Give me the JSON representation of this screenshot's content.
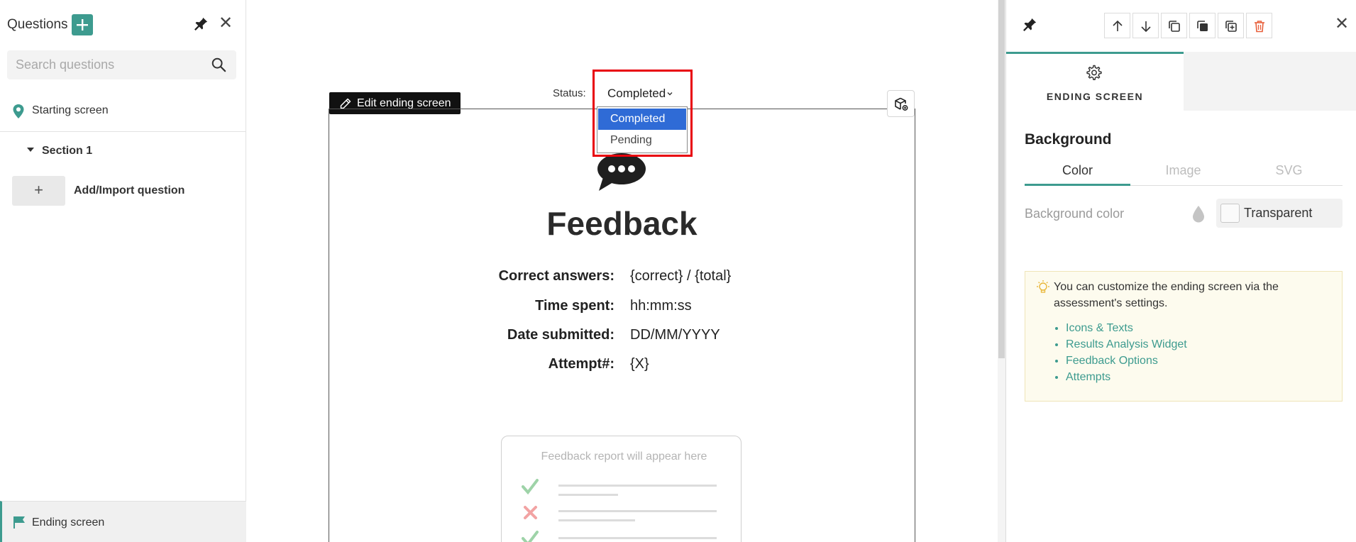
{
  "left_panel": {
    "title": "Questions",
    "add_icon": "plus-icon",
    "search_placeholder": "Search questions",
    "starting_screen": "Starting screen",
    "section": "Section 1",
    "add_import_symbol": "+",
    "add_import_label": "Add/Import question",
    "ending_screen": "Ending screen",
    "close_symbol": "✕"
  },
  "canvas": {
    "status_label": "Status:",
    "status_value": "Completed",
    "dropdown_options": [
      "Completed",
      "Pending"
    ],
    "edit_button": "Edit ending screen",
    "title": "Feedback",
    "rows": [
      {
        "key": "Correct answers:",
        "value": "{correct} / {total}"
      },
      {
        "key": "Time spent:",
        "value": "hh:mm:ss"
      },
      {
        "key": "Date submitted:",
        "value": "DD/MM/YYYY"
      },
      {
        "key": "Attempt#:",
        "value": "{X}"
      }
    ],
    "report_placeholder": "Feedback report will appear here"
  },
  "right_panel": {
    "tab_label": "ENDING SCREEN",
    "section_title": "Background",
    "subtabs": [
      "Color",
      "Image",
      "SVG"
    ],
    "active_subtab": "Color",
    "background_color_label": "Background color",
    "background_color_value": "Transparent",
    "tip_text": "You can customize the ending screen via the assessment's settings.",
    "tip_links": [
      "Icons & Texts",
      "Results Analysis Widget",
      "Feedback Options",
      "Attempts"
    ],
    "close_symbol": "✕"
  },
  "colors": {
    "accent": "#3d9b8f",
    "dropdown_selected": "#2f6bd6",
    "highlight": "#e8000b",
    "delete_icon": "#e8603c"
  }
}
